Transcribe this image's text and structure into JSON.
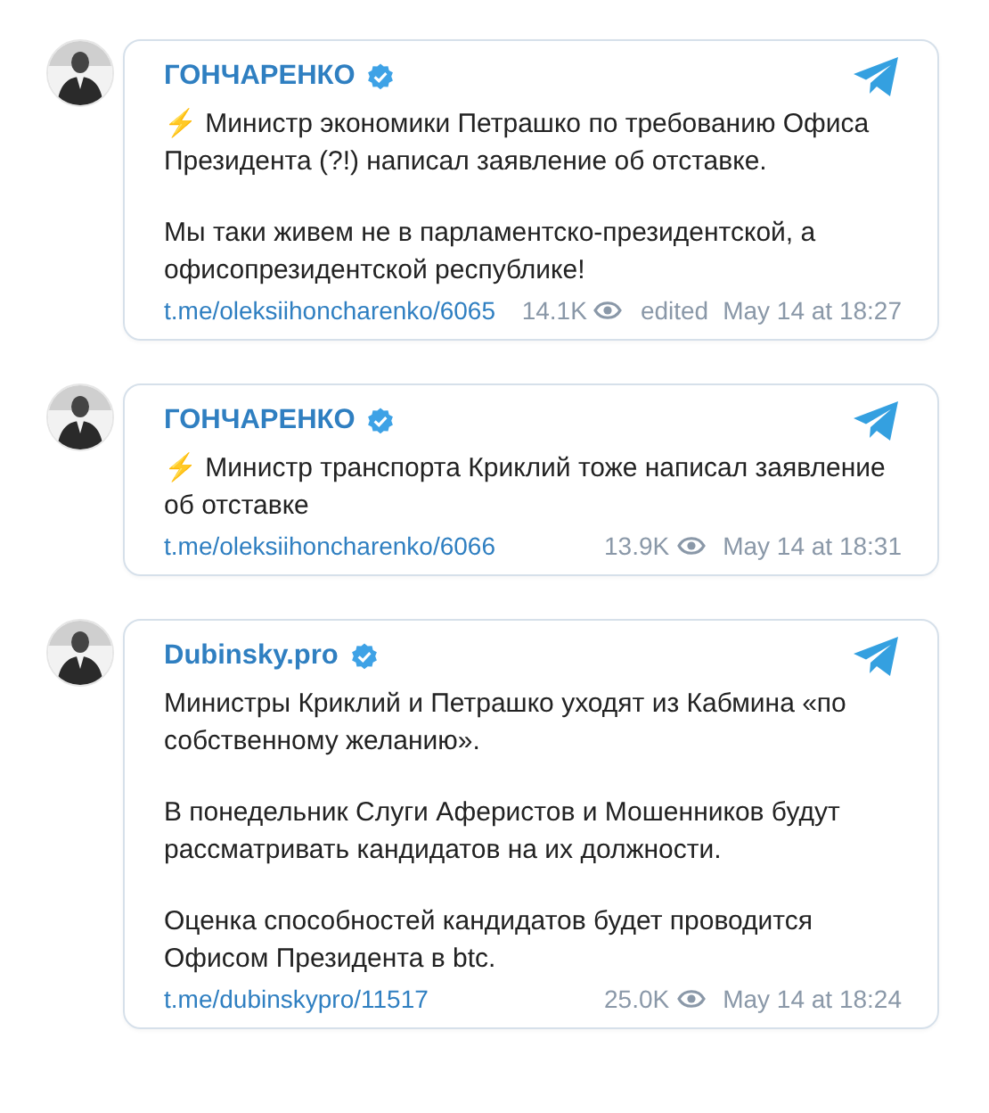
{
  "posts": [
    {
      "channel": "ГОНЧАРЕНКО",
      "verified": true,
      "avatar": {
        "kind": "picture"
      },
      "paragraphs": [
        "⚡️ Министр экономики Петрашко по требованию Офиса Президента (?!) написал заявление об отставке.",
        "Мы таки живем не в парламентско-президентской, а офисопрезидентской республике!"
      ],
      "link": "t.me/oleksiihoncharenko/6065",
      "views": "14.1K",
      "edited": "edited",
      "date": "May 14 at 18:27"
    },
    {
      "channel": "ГОНЧАРЕНКО",
      "verified": true,
      "avatar": {
        "kind": "picture"
      },
      "paragraphs": [
        "⚡️ Министр транспорта Криклий тоже написал заявление об отставке"
      ],
      "link": "t.me/oleksiihoncharenko/6066",
      "views": "13.9K",
      "date": "May 14 at 18:31"
    },
    {
      "channel": "Dubinsky.pro",
      "verified": true,
      "avatar": {
        "kind": "picture"
      },
      "paragraphs": [
        "Министры Криклий и Петрашко уходят из Кабмина «по собственному желанию».",
        "В понедельник Слуги Аферистов и Мошенников будут рассматривать кандидатов на их должности.",
        "Оценка способностей кандидатов будет проводится Офисом Президента в btc."
      ],
      "link": "t.me/dubinskypro/11517",
      "views": "25.0K",
      "date": "May 14 at 18:24"
    }
  ]
}
